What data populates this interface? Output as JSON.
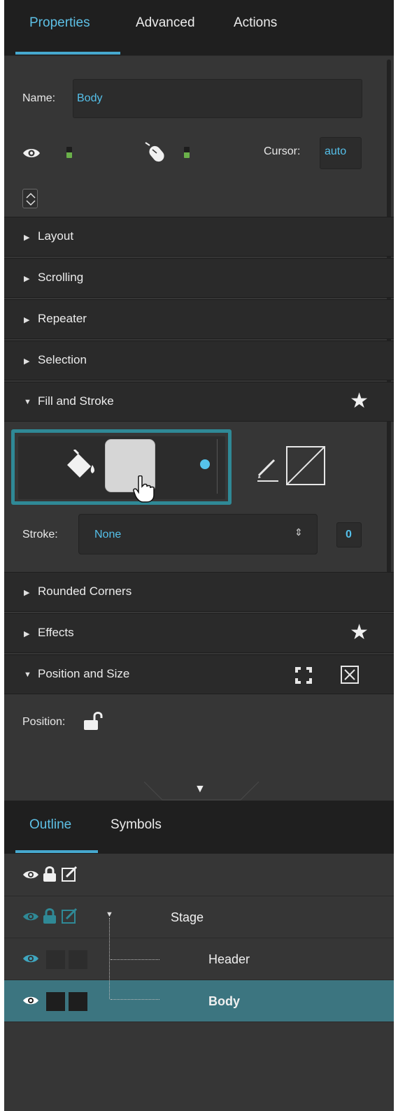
{
  "tabs": [
    {
      "label": "Properties",
      "active": true
    },
    {
      "label": "Advanced",
      "active": false
    },
    {
      "label": "Actions",
      "active": false
    }
  ],
  "properties": {
    "name_label": "Name:",
    "name_value": "Body",
    "cursor_label": "Cursor:",
    "cursor_value": "auto",
    "visible_icon": "eye-icon",
    "interaction_icon": "mouse-icon"
  },
  "sections": [
    {
      "label": "Layout",
      "expanded": false
    },
    {
      "label": "Scrolling",
      "expanded": false
    },
    {
      "label": "Repeater",
      "expanded": false
    },
    {
      "label": "Selection",
      "expanded": false
    },
    {
      "label": "Fill and Stroke",
      "expanded": true
    },
    {
      "label": "Rounded Corners",
      "expanded": false
    },
    {
      "label": "Effects",
      "expanded": false
    },
    {
      "label": "Position and Size",
      "expanded": true
    }
  ],
  "fill_stroke": {
    "fill_color": "#d6d6d6",
    "stroke_label": "Stroke:",
    "stroke_value": "None",
    "stroke_width": "0"
  },
  "position": {
    "label": "Position:"
  },
  "outline": {
    "tabs": [
      {
        "label": "Outline",
        "active": true
      },
      {
        "label": "Symbols",
        "active": false
      }
    ],
    "rows": [
      {
        "name": "Stage",
        "selected": false
      },
      {
        "name": "Header",
        "selected": false
      },
      {
        "name": "Body",
        "selected": true
      }
    ]
  },
  "colors": {
    "accent": "#55c0ea",
    "selection": "#3c7580",
    "highlight_border": "#2f8996",
    "panel_bg": "#363636",
    "header_bg": "#1f1f1f"
  }
}
